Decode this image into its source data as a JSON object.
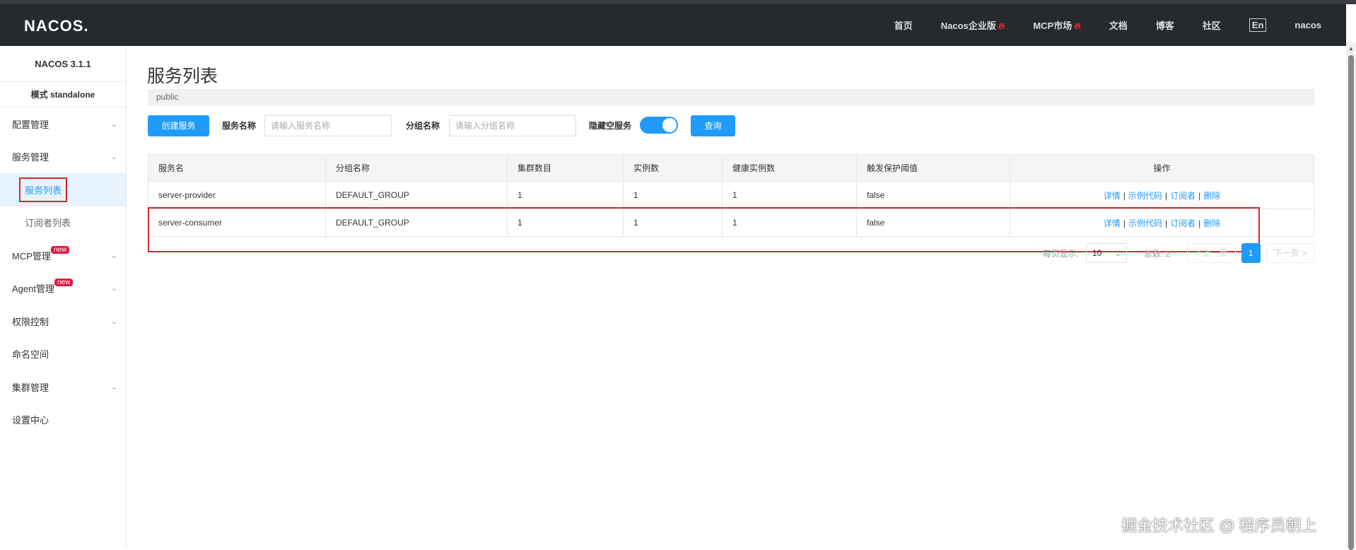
{
  "header": {
    "logo": "NACOS.",
    "nav": [
      {
        "label": "首页"
      },
      {
        "label": "Nacos企业版",
        "hot": true
      },
      {
        "label": "MCP市场",
        "hot": true
      },
      {
        "label": "文档"
      },
      {
        "label": "博客"
      },
      {
        "label": "社区"
      },
      {
        "label": "En"
      },
      {
        "label": "nacos"
      }
    ]
  },
  "sidebar": {
    "version": "NACOS 3.1.1",
    "mode": "模式 standalone",
    "items": [
      {
        "label": "配置管理"
      },
      {
        "label": "服务管理"
      },
      {
        "label": "服务列表"
      },
      {
        "label": "订阅者列表"
      },
      {
        "label": "MCP管理",
        "badge": "new"
      },
      {
        "label": "Agent管理",
        "badge": "new"
      },
      {
        "label": "权限控制"
      },
      {
        "label": "命名空间"
      },
      {
        "label": "集群管理"
      },
      {
        "label": "设置中心"
      }
    ]
  },
  "page": {
    "title": "服务列表",
    "namespace": "public"
  },
  "toolbar": {
    "create": "创建服务",
    "service_name_label": "服务名称",
    "service_name_placeholder": "请输入服务名称",
    "group_label": "分组名称",
    "group_placeholder": "请输入分组名称",
    "hide_empty_label": "隐藏空服务",
    "hide_empty_on": true,
    "query": "查询"
  },
  "table": {
    "headers": [
      "服务名",
      "分组名称",
      "集群数目",
      "实例数",
      "健康实例数",
      "触发保护阈值",
      "操作"
    ],
    "rows": [
      [
        "server-provider",
        "DEFAULT_GROUP",
        "1",
        "1",
        "1",
        "false"
      ],
      [
        "server-consumer",
        "DEFAULT_GROUP",
        "1",
        "1",
        "1",
        "false"
      ]
    ],
    "actions": [
      "详情",
      "示例代码",
      "订阅者",
      "删除"
    ]
  },
  "pagination": {
    "per_page_label": "每页显示:",
    "per_page": "10",
    "total_label": "总数: 2",
    "prev": "< 上一页",
    "current": "1",
    "next": "下一页 >"
  },
  "watermark": "掘金技术社区 @ 程序员朝上"
}
